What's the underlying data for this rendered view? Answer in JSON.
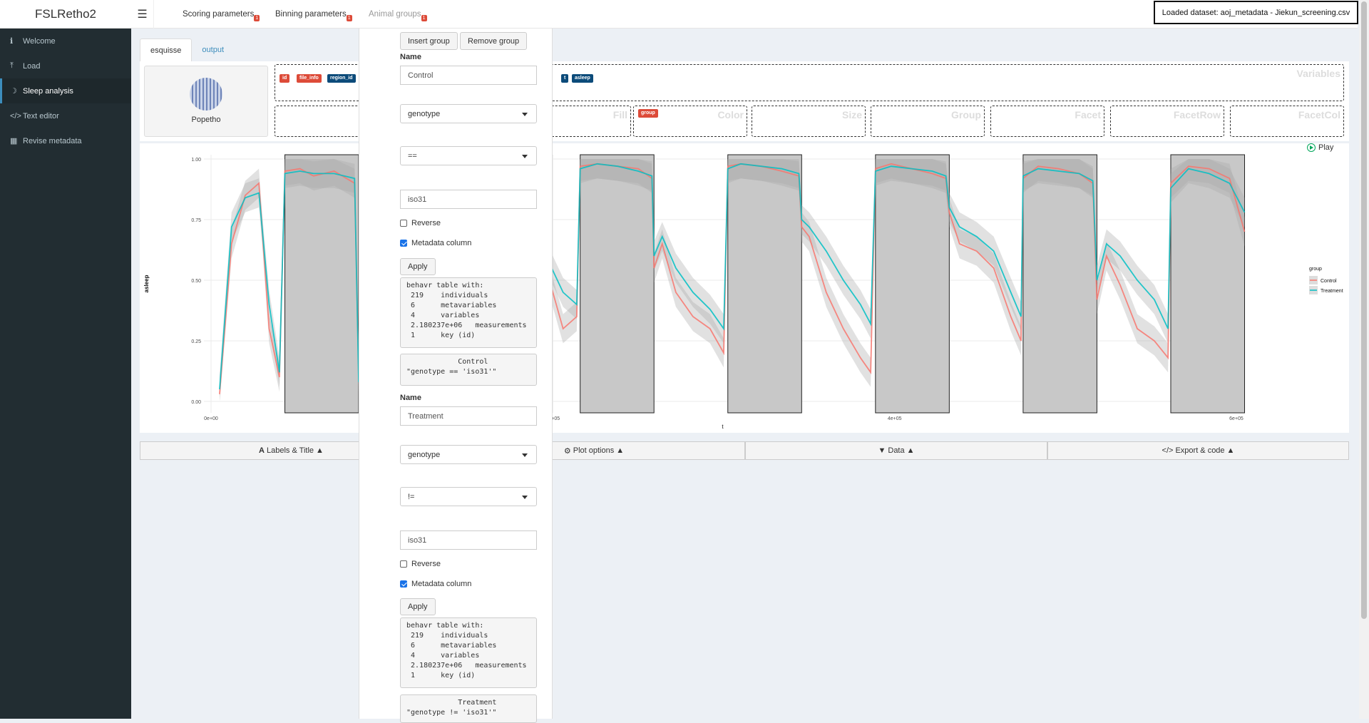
{
  "app": {
    "title": "FSLRetho2"
  },
  "header": {
    "tabs": [
      {
        "label": "Scoring parameters",
        "badge": "1"
      },
      {
        "label": "Binning parameters",
        "badge": "1"
      },
      {
        "label": "Animal groups",
        "badge": "1"
      }
    ],
    "dataset": "Loaded dataset: aoj_metadata - Jiekun_screening.csv"
  },
  "sidebar": {
    "items": [
      {
        "label": "Welcome",
        "icon": "info-icon"
      },
      {
        "label": "Load",
        "icon": "upload-icon"
      },
      {
        "label": "Sleep analysis",
        "icon": "moon-icon",
        "active": true
      },
      {
        "label": "Text editor",
        "icon": "code-icon"
      },
      {
        "label": "Revise metadata",
        "icon": "table-icon"
      }
    ]
  },
  "main": {
    "tabs": [
      "esquisse",
      "output"
    ],
    "popetho_label": "Popetho",
    "variables": {
      "chips": [
        "id",
        "file_info",
        "region_id",
        "t",
        "asleep"
      ],
      "zone_label": "Variables"
    },
    "zones": [
      "Fill",
      "Color",
      "Size",
      "Group",
      "Facet",
      "FacetRow",
      "FacetCol"
    ],
    "color_chip": "group",
    "play_label": "Play",
    "bottom_bar": [
      "Labels & Title",
      "Plot options",
      "Data",
      "Export & code"
    ]
  },
  "chart_data": {
    "type": "line",
    "xlabel": "t",
    "ylabel": "asleep",
    "ylim": [
      0,
      1
    ],
    "y_ticks": [
      "0.00",
      "0.25",
      "0.50",
      "0.75",
      "1.00"
    ],
    "x_ticks": [
      "0e+00",
      "2e+05",
      "4e+05",
      "6e+05"
    ],
    "xlim": [
      0,
      600000
    ],
    "legend": {
      "title": "group",
      "placement": "right",
      "entries": [
        "Control",
        "Treatment"
      ]
    },
    "colors": {
      "Control": "#f8766d",
      "Treatment": "#00bfc4",
      "ribbon": "#bdbdbd",
      "dark": "#8c8c8c"
    },
    "dark_periods": [
      [
        43200,
        86400
      ],
      [
        129600,
        172800
      ],
      [
        216000,
        259200
      ],
      [
        302400,
        345600
      ],
      [
        388800,
        432000
      ],
      [
        475200,
        518400
      ],
      [
        561600,
        604800
      ]
    ],
    "series": [
      {
        "name": "Control",
        "x": [
          5000,
          12000,
          20000,
          28000,
          34000,
          40000,
          43200,
          52000,
          60000,
          72000,
          84000,
          86400,
          90000,
          96000,
          104000,
          112000,
          120000,
          126000,
          129600,
          138000,
          148000,
          160000,
          170000,
          172800,
          178000,
          186000,
          196000,
          206000,
          214000,
          216000,
          226000,
          238000,
          250000,
          258000,
          259200,
          264000,
          272000,
          282000,
          292000,
          300000,
          302400,
          310000,
          322000,
          334000,
          344000,
          345600,
          350000,
          360000,
          370000,
          380000,
          386000,
          388800,
          398000,
          410000,
          422000,
          430000,
          432000,
          438000,
          448000,
          458000,
          468000,
          474000,
          475200,
          484000,
          496000,
          508000,
          516000,
          518400,
          524000,
          532000,
          542000,
          552000,
          560000,
          561600,
          572000,
          584000,
          596000,
          604800
        ],
        "values": [
          0.03,
          0.65,
          0.85,
          0.9,
          0.3,
          0.1,
          0.95,
          0.96,
          0.93,
          0.95,
          0.9,
          0.12,
          0.72,
          0.45,
          0.1,
          0.05,
          0.06,
          0.3,
          0.96,
          0.94,
          0.92,
          0.93,
          0.88,
          0.12,
          0.73,
          0.6,
          0.55,
          0.3,
          0.35,
          0.97,
          0.98,
          0.97,
          0.96,
          0.92,
          0.55,
          0.65,
          0.45,
          0.35,
          0.3,
          0.2,
          0.97,
          0.98,
          0.97,
          0.95,
          0.93,
          0.72,
          0.68,
          0.45,
          0.3,
          0.18,
          0.12,
          0.96,
          0.98,
          0.96,
          0.94,
          0.92,
          0.78,
          0.65,
          0.62,
          0.55,
          0.35,
          0.25,
          0.92,
          0.97,
          0.96,
          0.94,
          0.9,
          0.42,
          0.6,
          0.48,
          0.3,
          0.25,
          0.18,
          0.9,
          0.97,
          0.96,
          0.92,
          0.7
        ]
      },
      {
        "name": "Treatment",
        "x": [
          5000,
          12000,
          20000,
          28000,
          34000,
          40000,
          43200,
          52000,
          60000,
          72000,
          84000,
          86400,
          90000,
          96000,
          104000,
          112000,
          120000,
          126000,
          129600,
          138000,
          148000,
          160000,
          170000,
          172800,
          178000,
          186000,
          196000,
          206000,
          214000,
          216000,
          226000,
          238000,
          250000,
          258000,
          259200,
          264000,
          272000,
          282000,
          292000,
          300000,
          302400,
          310000,
          322000,
          334000,
          344000,
          345600,
          350000,
          360000,
          370000,
          380000,
          386000,
          388800,
          398000,
          410000,
          422000,
          430000,
          432000,
          438000,
          448000,
          458000,
          468000,
          474000,
          475200,
          484000,
          496000,
          508000,
          516000,
          518400,
          524000,
          532000,
          542000,
          552000,
          560000,
          561600,
          572000,
          584000,
          596000,
          604800
        ],
        "values": [
          0.05,
          0.72,
          0.84,
          0.86,
          0.4,
          0.12,
          0.94,
          0.95,
          0.94,
          0.94,
          0.92,
          0.08,
          0.8,
          0.6,
          0.2,
          0.02,
          0.05,
          0.35,
          0.95,
          0.93,
          0.91,
          0.92,
          0.9,
          0.15,
          0.68,
          0.65,
          0.6,
          0.45,
          0.4,
          0.96,
          0.98,
          0.97,
          0.95,
          0.93,
          0.6,
          0.68,
          0.55,
          0.45,
          0.38,
          0.3,
          0.96,
          0.98,
          0.97,
          0.96,
          0.94,
          0.75,
          0.72,
          0.62,
          0.5,
          0.4,
          0.32,
          0.95,
          0.97,
          0.96,
          0.95,
          0.93,
          0.8,
          0.72,
          0.68,
          0.62,
          0.45,
          0.35,
          0.93,
          0.96,
          0.95,
          0.94,
          0.91,
          0.5,
          0.65,
          0.6,
          0.5,
          0.42,
          0.3,
          0.88,
          0.96,
          0.94,
          0.9,
          0.78
        ]
      }
    ]
  },
  "panel": {
    "insert_label": "Insert group",
    "remove_label": "Remove group",
    "groups": [
      {
        "name_label": "Name",
        "name": "Control",
        "column": "genotype",
        "operator": "==",
        "value": "iso31",
        "reverse_label": "Reverse",
        "metadata_label": "Metadata column",
        "apply_label": "Apply",
        "summary": "behavr table with:\n 219    individuals\n 6      metavariables\n 4      variables\n 2.180237e+06   measurements\n 1      key (id)",
        "expr": "            Control\n\"genotype == 'iso31'\""
      },
      {
        "name_label": "Name",
        "name": "Treatment",
        "column": "genotype",
        "operator": "!=",
        "value": "iso31",
        "reverse_label": "Reverse",
        "metadata_label": "Metadata column",
        "apply_label": "Apply",
        "summary": "behavr table with:\n 219    individuals\n 6      metavariables\n 4      variables\n 2.180237e+06   measurements\n 1      key (id)",
        "expr": "            Treatment\n\"genotype != 'iso31'\""
      }
    ]
  }
}
